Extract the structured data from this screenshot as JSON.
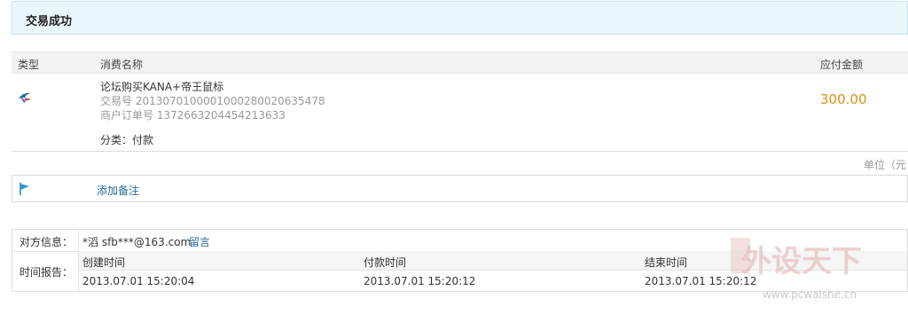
{
  "header": {
    "title": "交易成功"
  },
  "table": {
    "col_type": "类型",
    "col_name": "消费名称",
    "col_amount": "应付金额"
  },
  "item": {
    "icon": "bird-logo-icon",
    "name": "论坛购买KANA+帝王鼠标",
    "trade_no": "交易号 2013070100001000280020635478",
    "merchant_order": "商户订单号 1372663204454213633",
    "amount": "300.00",
    "category": "分类：付款"
  },
  "unit_label": "单位（元",
  "note": {
    "icon": "flag-icon",
    "label": "添加备注"
  },
  "info": {
    "counterparty_label": "对方信息：",
    "counterparty_value": "*滔 sfb***@163.com",
    "message_link": "留言",
    "time_label": "时间报告：",
    "created_label": "创建时间",
    "paid_label": "付款时间",
    "finished_label": "结束时间",
    "created_value": "2013.07.01 15:20:04",
    "paid_value": "2013.07.01 15:20:12",
    "finished_value": "2013.07.01 15:20:12"
  },
  "watermark": {
    "text": "外设天下",
    "url": "www.pcwaishe.cn"
  },
  "colors": {
    "amount": "#e08e12",
    "link": "#246e9c",
    "header_bg": "#e9f6fc"
  }
}
